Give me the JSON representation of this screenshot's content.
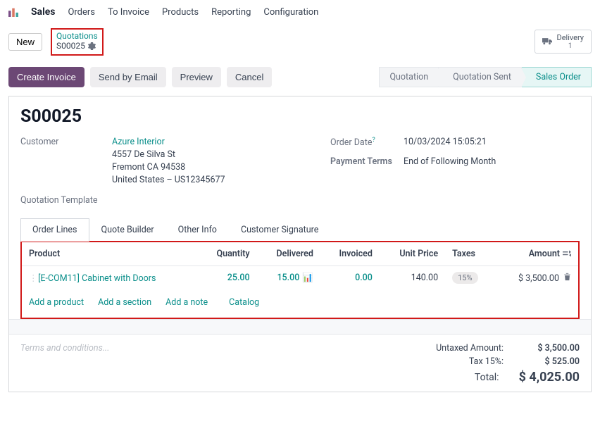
{
  "nav": {
    "app": "Sales",
    "items": [
      "Orders",
      "To Invoice",
      "Products",
      "Reporting",
      "Configuration"
    ]
  },
  "crumb": {
    "new": "New",
    "top": "Quotations",
    "bottom": "S00025"
  },
  "delivery": {
    "label": "Delivery",
    "count": "1"
  },
  "actions": {
    "create_invoice": "Create Invoice",
    "send_email": "Send by Email",
    "preview": "Preview",
    "cancel": "Cancel"
  },
  "steps": [
    "Quotation",
    "Quotation Sent",
    "Sales Order"
  ],
  "order": {
    "title": "S00025",
    "customer_label": "Customer",
    "customer_name": "Azure Interior",
    "address1": "4557 De Silva St",
    "address2": "Fremont CA 94538",
    "address3": "United States – US12345677",
    "qtpl_label": "Quotation Template",
    "order_date_label": "Order Date",
    "order_date_value": "10/03/2024 15:05:21",
    "payterms_label": "Payment Terms",
    "payterms_value": "End of Following Month"
  },
  "tabs": [
    "Order Lines",
    "Quote Builder",
    "Other Info",
    "Customer Signature"
  ],
  "table": {
    "headers": {
      "product": "Product",
      "quantity": "Quantity",
      "delivered": "Delivered",
      "invoiced": "Invoiced",
      "unit_price": "Unit Price",
      "taxes": "Taxes",
      "amount": "Amount"
    },
    "row": {
      "product": "[E-COM11] Cabinet with Doors",
      "quantity": "25.00",
      "delivered": "15.00",
      "invoiced": "0.00",
      "unit_price": "140.00",
      "tax": "15%",
      "amount": "$ 3,500.00"
    },
    "links": {
      "add_product": "Add a product",
      "add_section": "Add a section",
      "add_note": "Add a note",
      "catalog": "Catalog"
    }
  },
  "footer": {
    "terms_placeholder": "Terms and conditions...",
    "untaxed_label": "Untaxed Amount:",
    "untaxed_val": "$ 3,500.00",
    "tax_label": "Tax 15%:",
    "tax_val": "$ 525.00",
    "total_label": "Total:",
    "total_val": "$ 4,025.00"
  }
}
